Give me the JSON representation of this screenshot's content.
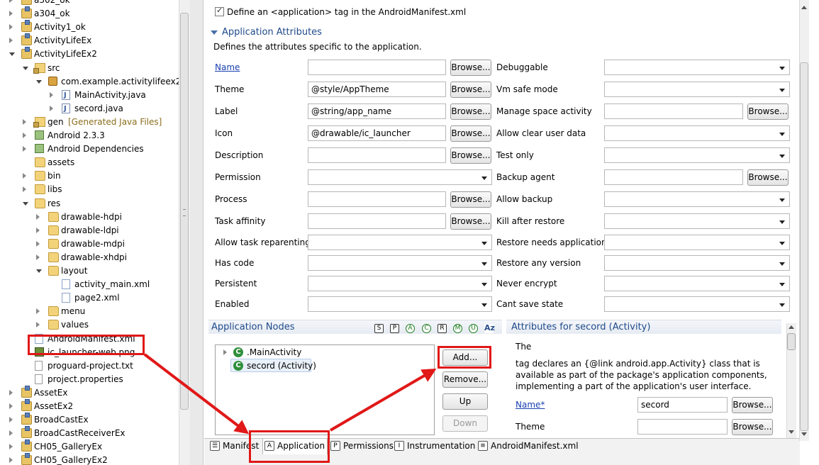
{
  "explorer": {
    "items": [
      {
        "label": "a302_ok",
        "icon": "project-icon",
        "twisty": "closed"
      },
      {
        "label": "a304_ok",
        "icon": "project-icon",
        "twisty": "closed"
      },
      {
        "label": "Activity1_ok",
        "icon": "project-icon",
        "twisty": "closed"
      },
      {
        "label": "ActivityLifeEx",
        "icon": "project-icon",
        "twisty": "closed"
      },
      {
        "label": "ActivityLifeEx2",
        "icon": "project-icon",
        "twisty": "open"
      },
      {
        "label": "src",
        "icon": "source-folder-icon",
        "twisty": "open"
      },
      {
        "label": "com.example.activitylifeex2",
        "icon": "package-icon",
        "twisty": "open"
      },
      {
        "label": "MainActivity.java",
        "icon": "java-file-icon",
        "twisty": "closed"
      },
      {
        "label": "secord.java",
        "icon": "java-file-icon",
        "twisty": "closed"
      },
      {
        "label": "gen",
        "suffix": "[Generated Java Files]",
        "icon": "source-folder-icon",
        "twisty": "closed"
      },
      {
        "label": "Android 2.3.3",
        "icon": "library-icon",
        "twisty": "closed"
      },
      {
        "label": "Android Dependencies",
        "icon": "library-icon",
        "twisty": "closed"
      },
      {
        "label": "assets",
        "icon": "folder-icon",
        "twisty": "none"
      },
      {
        "label": "bin",
        "icon": "folder-icon",
        "twisty": "closed"
      },
      {
        "label": "libs",
        "icon": "folder-icon",
        "twisty": "closed"
      },
      {
        "label": "res",
        "icon": "folder-icon",
        "twisty": "open"
      },
      {
        "label": "drawable-hdpi",
        "icon": "folder-icon",
        "twisty": "closed"
      },
      {
        "label": "drawable-ldpi",
        "icon": "folder-icon",
        "twisty": "closed"
      },
      {
        "label": "drawable-mdpi",
        "icon": "folder-icon",
        "twisty": "closed"
      },
      {
        "label": "drawable-xhdpi",
        "icon": "folder-icon",
        "twisty": "closed"
      },
      {
        "label": "layout",
        "icon": "folder-icon",
        "twisty": "open"
      },
      {
        "label": "activity_main.xml",
        "icon": "xml-file-icon",
        "twisty": "none"
      },
      {
        "label": "page2.xml",
        "icon": "xml-file-icon",
        "twisty": "none"
      },
      {
        "label": "menu",
        "icon": "folder-icon",
        "twisty": "closed"
      },
      {
        "label": "values",
        "icon": "folder-icon",
        "twisty": "closed"
      },
      {
        "label": "AndroidManifest.xml",
        "icon": "manifest-file-icon",
        "twisty": "none"
      },
      {
        "label": "ic_launcher-web.png",
        "icon": "image-file-icon",
        "twisty": "none"
      },
      {
        "label": "proguard-project.txt",
        "icon": "text-file-icon",
        "twisty": "none"
      },
      {
        "label": "project.properties",
        "icon": "text-file-icon",
        "twisty": "none"
      },
      {
        "label": "AssetEx",
        "icon": "project-icon",
        "twisty": "closed"
      },
      {
        "label": "AssetEx2",
        "icon": "project-icon",
        "twisty": "closed"
      },
      {
        "label": "BroadCastEx",
        "icon": "project-icon",
        "twisty": "closed"
      },
      {
        "label": "BroadCastReceiverEx",
        "icon": "project-icon",
        "twisty": "closed"
      },
      {
        "label": "CH05_GalleryEx",
        "icon": "project-icon",
        "twisty": "closed"
      },
      {
        "label": "CH05_GalleryEx2",
        "icon": "project-icon",
        "twisty": "closed"
      }
    ]
  },
  "editor": {
    "define_tag_checkbox": {
      "label": "Define an <application> tag in the AndroidManifest.xml",
      "checked": true
    },
    "app_attributes": {
      "title": "Application Attributes",
      "description": "Defines the attributes specific to the application.",
      "left_fields": [
        {
          "label": "Name",
          "type": "text-browse",
          "value": "",
          "link": true
        },
        {
          "label": "Theme",
          "type": "text-browse",
          "value": "@style/AppTheme"
        },
        {
          "label": "Label",
          "type": "text-browse",
          "value": "@string/app_name"
        },
        {
          "label": "Icon",
          "type": "text-browse",
          "value": "@drawable/ic_launcher"
        },
        {
          "label": "Description",
          "type": "text-browse",
          "value": ""
        },
        {
          "label": "Permission",
          "type": "combo",
          "value": ""
        },
        {
          "label": "Process",
          "type": "text-browse",
          "value": ""
        },
        {
          "label": "Task affinity",
          "type": "text-browse",
          "value": ""
        },
        {
          "label": "Allow task reparenting",
          "type": "combo",
          "value": ""
        },
        {
          "label": "Has code",
          "type": "combo",
          "value": ""
        },
        {
          "label": "Persistent",
          "type": "combo",
          "value": ""
        },
        {
          "label": "Enabled",
          "type": "combo",
          "value": ""
        }
      ],
      "right_fields": [
        {
          "label": "Debuggable",
          "type": "combo",
          "value": ""
        },
        {
          "label": "Vm safe mode",
          "type": "combo",
          "value": ""
        },
        {
          "label": "Manage space activity",
          "type": "text-browse",
          "value": ""
        },
        {
          "label": "Allow clear user data",
          "type": "combo",
          "value": ""
        },
        {
          "label": "Test only",
          "type": "combo",
          "value": ""
        },
        {
          "label": "Backup agent",
          "type": "text-browse",
          "value": ""
        },
        {
          "label": "Allow backup",
          "type": "combo",
          "value": ""
        },
        {
          "label": "Kill after restore",
          "type": "combo",
          "value": ""
        },
        {
          "label": "Restore needs application",
          "type": "combo",
          "value": ""
        },
        {
          "label": "Restore any version",
          "type": "combo",
          "value": ""
        },
        {
          "label": "Never encrypt",
          "type": "combo",
          "value": ""
        },
        {
          "label": "Cant save state",
          "type": "combo",
          "value": ""
        }
      ],
      "browse_label": "Browse..."
    },
    "app_nodes": {
      "title": "Application Nodes",
      "filter_icons": [
        "S",
        "P",
        "A",
        "C",
        "R",
        "M",
        "U",
        "Az"
      ],
      "nodes": [
        {
          "label": ".MainActivity",
          "icon": "C"
        },
        {
          "label": "secord (Activity)",
          "icon": "C"
        }
      ],
      "buttons": {
        "add": "Add...",
        "remove": "Remove...",
        "up": "Up",
        "down": "Down"
      }
    },
    "node_attributes": {
      "title": "Attributes for secord (Activity)",
      "desc_line1": "The",
      "desc_line2": " tag declares an {@link android.app.Activity} class that is",
      "desc_line3": "available as part of the package's application components,",
      "desc_line4": "implementing a part of the application's user interface.",
      "fields": [
        {
          "label": "Name*",
          "value": "secord",
          "link": true
        },
        {
          "label": "Theme",
          "value": ""
        }
      ],
      "browse_label": "Browse..."
    },
    "bottom_tabs": [
      {
        "label": "Manifest",
        "icon": "manifest-tab-icon",
        "glyph": "☰"
      },
      {
        "label": "Application",
        "icon": "application-tab-icon",
        "glyph": "A",
        "selected": true
      },
      {
        "label": "Permissions",
        "icon": "permissions-tab-icon",
        "glyph": "P"
      },
      {
        "label": "Instrumentation",
        "icon": "instrumentation-tab-icon",
        "glyph": "I"
      },
      {
        "label": "AndroidManifest.xml",
        "icon": "xml-tab-icon",
        "glyph": "≡"
      }
    ]
  },
  "colors": {
    "annotation_red": "#e01818",
    "section_title_blue": "#1f4a8a",
    "link_blue": "#1a40b0",
    "node_icon_green": "#2f8f3a"
  }
}
